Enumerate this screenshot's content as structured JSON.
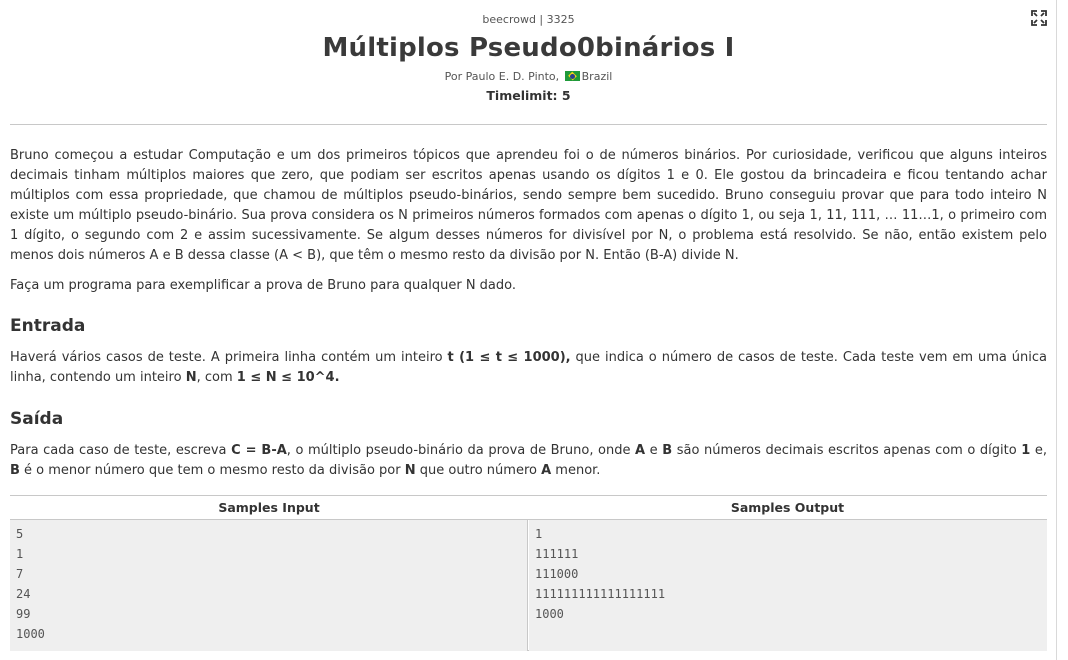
{
  "header": {
    "source": "beecrowd | 3325",
    "title": "Múltiplos Pseudo0binários I",
    "author_prefix": "Por Paulo E. D. Pinto,",
    "country": "Brazil",
    "timelimit": "Timelimit: 5"
  },
  "statement": {
    "p1": "Bruno começou a estudar Computação e um dos primeiros tópicos que aprendeu foi o de números binários. Por curiosidade, verificou que alguns inteiros decimais tinham múltiplos maiores que zero, que podiam ser escritos apenas usando os dígitos 1 e 0. Ele gostou da brincadeira e ficou tentando achar múltiplos com essa propriedade, que chamou de múltiplos pseudo-binários, sendo sempre bem sucedido. Bruno conseguiu provar que para todo inteiro N existe um múltiplo pseudo-binário. Sua prova considera os N primeiros números formados com apenas o dígito 1, ou seja 1, 11, 111, … 11…1, o primeiro com 1 dígito, o segundo com 2 e assim sucessivamente. Se algum desses números for divisível por N, o problema está resolvido. Se não, então existem pelo menos dois números A e B dessa classe (A < B), que têm o mesmo resto da divisão por N. Então (B-A) divide N.",
    "p2": "Faça um programa para exemplificar a prova de Bruno para qualquer N dado."
  },
  "input_section": {
    "heading": "Entrada",
    "t1": "Haverá vários casos de teste. A primeira linha contém um inteiro ",
    "b1": "t (1 ≤ t ≤ 1000),",
    "t2": " que indica o número de casos de teste. Cada teste vem em uma única linha, contendo um inteiro ",
    "b2": "N",
    "t3": ", com ",
    "b3": "1 ≤ N ≤ 10^4."
  },
  "output_section": {
    "heading": "Saída",
    "t1": "Para cada caso de teste, escreva ",
    "b1": "C = B-A",
    "t2": ", o múltiplo pseudo-binário da prova de Bruno, onde ",
    "b2": "A",
    "t3": " e ",
    "b3": "B",
    "t4": " são números decimais escritos apenas com o dígito ",
    "b4": "1",
    "t5": " e, ",
    "b5": "B",
    "t6": " é o menor número que tem o mesmo resto da divisão por ",
    "b6": "N",
    "t7": " que outro número ",
    "b7": "A",
    "t8": " menor."
  },
  "samples": {
    "input_header": "Samples Input",
    "output_header": "Samples Output",
    "input_lines": [
      "5",
      "1",
      "7",
      "24",
      "99",
      "1000"
    ],
    "output_lines": [
      "1",
      "111111",
      "111000",
      "111111111111111111",
      "1000"
    ]
  },
  "icons": {
    "expand": "expand-icon",
    "flag": "brazil-flag-icon"
  }
}
